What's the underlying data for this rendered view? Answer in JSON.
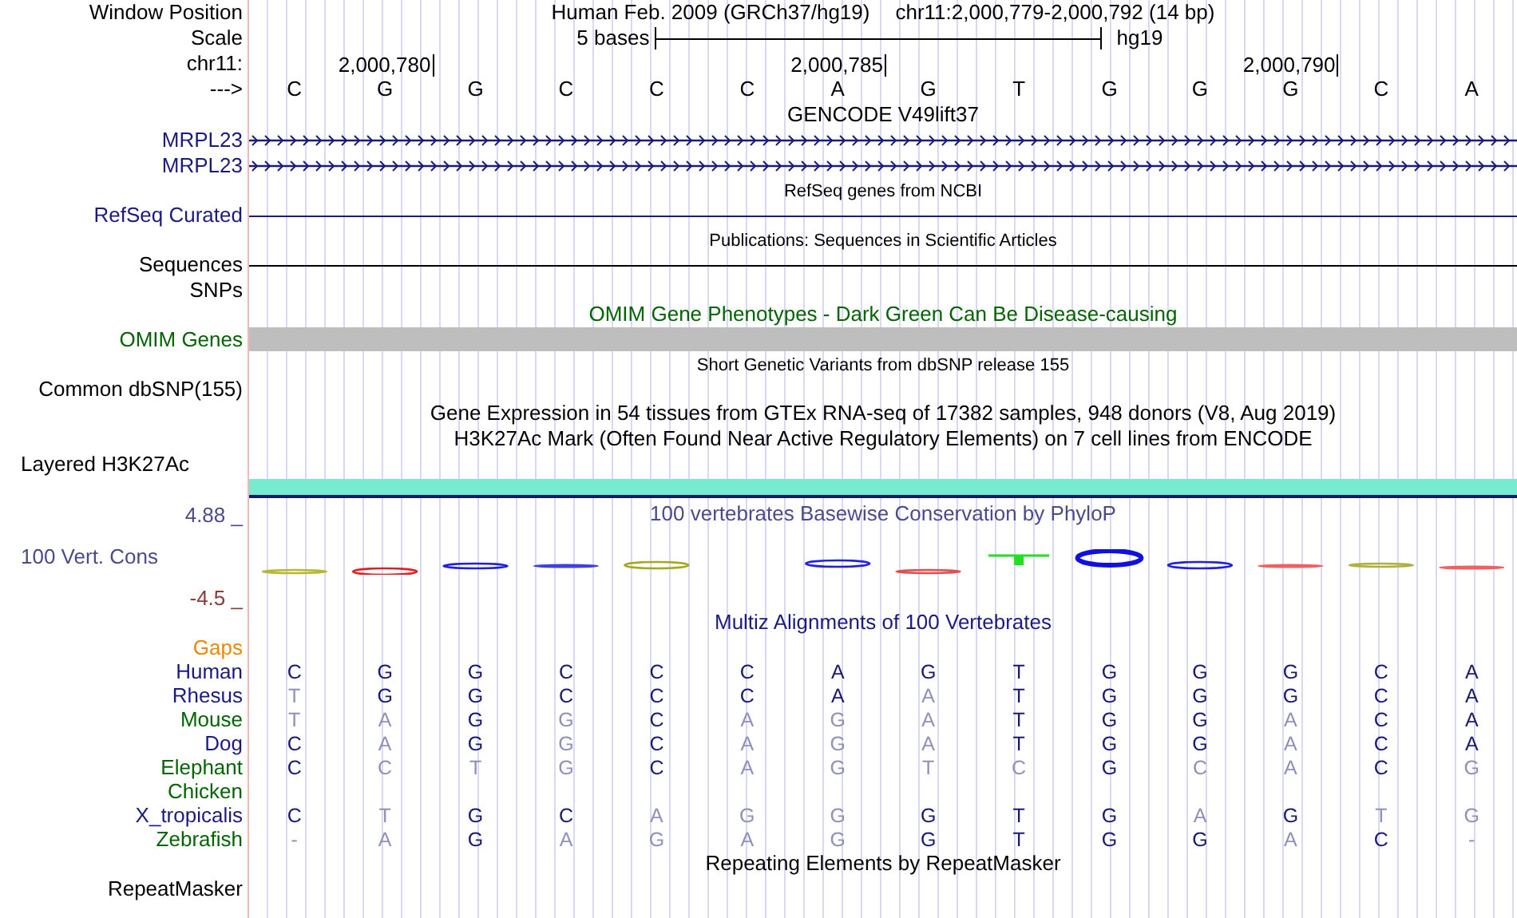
{
  "header": {
    "label": "Window Position",
    "assembly": "Human Feb. 2009 (GRCh37/hg19)",
    "position": "chr11:2,000,779-2,000,792 (14 bp)"
  },
  "scale": {
    "label": "Scale",
    "span": "5 bases",
    "db": "hg19"
  },
  "ruler": {
    "label": "chr11:",
    "strand": "--->",
    "bases": [
      {
        "base": "C"
      },
      {
        "base": "G",
        "tick": "2,000,780"
      },
      {
        "base": "G"
      },
      {
        "base": "C"
      },
      {
        "base": "C"
      },
      {
        "base": "C"
      },
      {
        "base": "A",
        "tick": "2,000,785"
      },
      {
        "base": "G"
      },
      {
        "base": "T"
      },
      {
        "base": "G"
      },
      {
        "base": "G"
      },
      {
        "base": "G",
        "tick": "2,000,790"
      },
      {
        "base": "C"
      },
      {
        "base": "A"
      }
    ]
  },
  "tracks": [
    {
      "kind": "title",
      "title": "GENCODE V49lift37",
      "color": "#000000"
    },
    {
      "kind": "gene",
      "label": "MRPL23",
      "color": "#1a1a80"
    },
    {
      "kind": "gene",
      "label": "MRPL23",
      "color": "#1a1a80"
    },
    {
      "kind": "small_title",
      "title": "RefSeq genes from NCBI",
      "color": "#000000"
    },
    {
      "kind": "line",
      "label": "RefSeq Curated",
      "color": "#1a1a80"
    },
    {
      "kind": "small_title",
      "title": "Publications: Sequences in Scientific Articles",
      "color": "#000000"
    },
    {
      "kind": "line",
      "label": "Sequences",
      "color": "#000000"
    },
    {
      "kind": "empty",
      "label": "SNPs",
      "color": "#000000"
    },
    {
      "kind": "title",
      "title": "OMIM Gene Phenotypes - Dark Green Can Be Disease-causing",
      "color": "#006400"
    },
    {
      "kind": "omim_bar",
      "label": "OMIM Genes",
      "color": "#006400"
    },
    {
      "kind": "small_title",
      "title": "Short Genetic Variants from dbSNP release 155",
      "color": "#000000"
    },
    {
      "kind": "empty",
      "label": "Common dbSNP(155)",
      "color": "#000000"
    },
    {
      "kind": "title",
      "title": "Gene Expression in 54 tissues from GTEx RNA-seq of 17382 samples, 948 donors (V8, Aug 2019)",
      "color": "#000000"
    },
    {
      "kind": "title",
      "title": "H3K27Ac Mark (Often Found Near Active Regulatory Elements) on 7 cell lines from ENCODE",
      "color": "#000000"
    },
    {
      "kind": "signal_bar",
      "label": "Layered H3K27Ac",
      "color": "#000000"
    },
    {
      "kind": "conservation",
      "title": "100 vertebrates Basewise Conservation by PhyloP",
      "label": "100 Vert. Cons",
      "max": "4.88 _",
      "min": "-4.5 _",
      "color": "#4a4a8c"
    },
    {
      "kind": "title",
      "title": "Multiz Alignments of 100 Vertebrates",
      "color": "#1a1a80"
    },
    {
      "kind": "empty",
      "label": "Gaps",
      "color": "#ee8800"
    },
    {
      "kind": "species",
      "label": "Human",
      "color": "#1a1a80",
      "bases": [
        {
          "base": "C",
          "match": true
        },
        {
          "base": "G",
          "match": true
        },
        {
          "base": "G",
          "match": true
        },
        {
          "base": "C",
          "match": true
        },
        {
          "base": "C",
          "match": true
        },
        {
          "base": "C",
          "match": true
        },
        {
          "base": "A",
          "match": true
        },
        {
          "base": "G",
          "match": true
        },
        {
          "base": "T",
          "match": true
        },
        {
          "base": "G",
          "match": true
        },
        {
          "base": "G",
          "match": true
        },
        {
          "base": "G",
          "match": true
        },
        {
          "base": "C",
          "match": true
        },
        {
          "base": "A",
          "match": true
        }
      ]
    },
    {
      "kind": "species",
      "label": "Rhesus",
      "color": "#1a1a80",
      "bases": [
        {
          "base": "T",
          "match": false
        },
        {
          "base": "G",
          "match": true
        },
        {
          "base": "G",
          "match": true
        },
        {
          "base": "C",
          "match": true
        },
        {
          "base": "C",
          "match": true
        },
        {
          "base": "C",
          "match": true
        },
        {
          "base": "A",
          "match": true
        },
        {
          "base": "A",
          "match": false
        },
        {
          "base": "T",
          "match": true
        },
        {
          "base": "G",
          "match": true
        },
        {
          "base": "G",
          "match": true
        },
        {
          "base": "G",
          "match": true
        },
        {
          "base": "C",
          "match": true
        },
        {
          "base": "A",
          "match": true
        }
      ]
    },
    {
      "kind": "species",
      "label": "Mouse",
      "color": "#006400",
      "bases": [
        {
          "base": "T",
          "match": false
        },
        {
          "base": "A",
          "match": false
        },
        {
          "base": "G",
          "match": true
        },
        {
          "base": "G",
          "match": false
        },
        {
          "base": "C",
          "match": true
        },
        {
          "base": "A",
          "match": false
        },
        {
          "base": "G",
          "match": false
        },
        {
          "base": "A",
          "match": false
        },
        {
          "base": "T",
          "match": true
        },
        {
          "base": "G",
          "match": true
        },
        {
          "base": "G",
          "match": true
        },
        {
          "base": "A",
          "match": false
        },
        {
          "base": "C",
          "match": true
        },
        {
          "base": "A",
          "match": true
        }
      ]
    },
    {
      "kind": "species",
      "label": "Dog",
      "color": "#1a1a80",
      "bases": [
        {
          "base": "C",
          "match": true
        },
        {
          "base": "A",
          "match": false
        },
        {
          "base": "G",
          "match": true
        },
        {
          "base": "G",
          "match": false
        },
        {
          "base": "C",
          "match": true
        },
        {
          "base": "A",
          "match": false
        },
        {
          "base": "G",
          "match": false
        },
        {
          "base": "A",
          "match": false
        },
        {
          "base": "T",
          "match": true
        },
        {
          "base": "G",
          "match": true
        },
        {
          "base": "G",
          "match": true
        },
        {
          "base": "A",
          "match": false
        },
        {
          "base": "C",
          "match": true
        },
        {
          "base": "A",
          "match": true
        }
      ]
    },
    {
      "kind": "species",
      "label": "Elephant",
      "color": "#006400",
      "bases": [
        {
          "base": "C",
          "match": true
        },
        {
          "base": "C",
          "match": false
        },
        {
          "base": "T",
          "match": false
        },
        {
          "base": "G",
          "match": false
        },
        {
          "base": "C",
          "match": true
        },
        {
          "base": "A",
          "match": false
        },
        {
          "base": "G",
          "match": false
        },
        {
          "base": "T",
          "match": false
        },
        {
          "base": "C",
          "match": false
        },
        {
          "base": "G",
          "match": true
        },
        {
          "base": "C",
          "match": false
        },
        {
          "base": "A",
          "match": false
        },
        {
          "base": "C",
          "match": true
        },
        {
          "base": "G",
          "match": false
        }
      ]
    },
    {
      "kind": "species",
      "label": "Chicken",
      "color": "#006400"
    },
    {
      "kind": "species",
      "label": "X_tropicalis",
      "color": "#1a1a80",
      "bases": [
        {
          "base": "C",
          "match": true
        },
        {
          "base": "T",
          "match": false
        },
        {
          "base": "G",
          "match": true
        },
        {
          "base": "C",
          "match": true
        },
        {
          "base": "A",
          "match": false
        },
        {
          "base": "G",
          "match": false
        },
        {
          "base": "G",
          "match": false
        },
        {
          "base": "G",
          "match": true
        },
        {
          "base": "T",
          "match": true
        },
        {
          "base": "G",
          "match": true
        },
        {
          "base": "A",
          "match": false
        },
        {
          "base": "G",
          "match": true
        },
        {
          "base": "T",
          "match": false
        },
        {
          "base": "G",
          "match": false
        }
      ]
    },
    {
      "kind": "species",
      "label": "Zebrafish",
      "color": "#006400",
      "bases": [
        {
          "base": "-",
          "match": false
        },
        {
          "base": "A",
          "match": false
        },
        {
          "base": "G",
          "match": true
        },
        {
          "base": "A",
          "match": false
        },
        {
          "base": "G",
          "match": false
        },
        {
          "base": "A",
          "match": false
        },
        {
          "base": "G",
          "match": false
        },
        {
          "base": "G",
          "match": true
        },
        {
          "base": "T",
          "match": true
        },
        {
          "base": "G",
          "match": true
        },
        {
          "base": "G",
          "match": true
        },
        {
          "base": "A",
          "match": false
        },
        {
          "base": "C",
          "match": true
        },
        {
          "base": "-",
          "match": false
        }
      ]
    },
    {
      "kind": "title",
      "title": "Repeating Elements by RepeatMasker",
      "color": "#000000"
    },
    {
      "kind": "empty",
      "label": "RepeatMasker",
      "color": "#000000"
    }
  ]
}
